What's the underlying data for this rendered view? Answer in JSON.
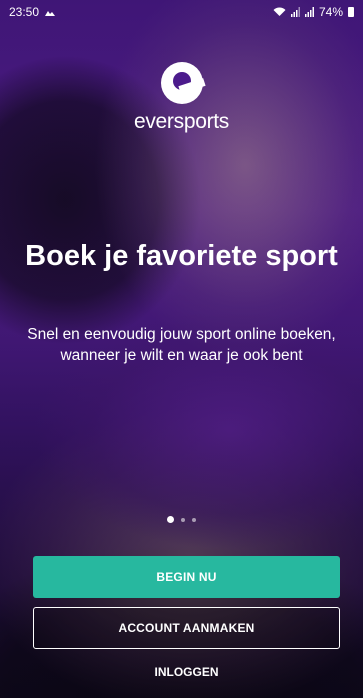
{
  "status_bar": {
    "time": "23:50",
    "battery": "74%",
    "icons": [
      "wifi-icon",
      "signal-icon",
      "signal-icon",
      "battery-icon"
    ]
  },
  "brand": {
    "name": "eversports",
    "logo_icon": "eversports-logo-icon"
  },
  "onboarding": {
    "headline": "Boek je favoriete sport",
    "description": "Snel en eenvoudig jouw sport online boeken, wanneer je wilt en waar je ook bent",
    "page_count": 3,
    "active_page": 1
  },
  "actions": {
    "primary_label": "BEGIN NU",
    "create_account_label": "ACCOUNT AANMAKEN",
    "login_label": "INLOGGEN"
  },
  "colors": {
    "primary_button": "#27b89f",
    "background_tint": "#4a1a8a"
  }
}
